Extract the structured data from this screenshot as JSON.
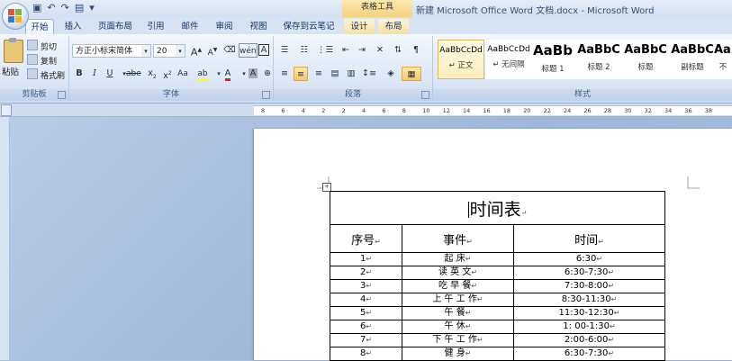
{
  "window": {
    "title": "新建 Microsoft Office Word 文档.docx - Microsoft Word",
    "context_group": "表格工具"
  },
  "tabs": [
    {
      "label": "开始",
      "active": true
    },
    {
      "label": "插入"
    },
    {
      "label": "页面布局"
    },
    {
      "label": "引用"
    },
    {
      "label": "邮件"
    },
    {
      "label": "审阅"
    },
    {
      "label": "视图"
    },
    {
      "label": "保存到云笔记"
    },
    {
      "label": "设计",
      "context": true
    },
    {
      "label": "布局",
      "context": true
    }
  ],
  "clipboard": {
    "paste": "粘贴",
    "cut": "剪切",
    "copy": "复制",
    "format_painter": "格式刷",
    "label": "剪贴板"
  },
  "font": {
    "name": "方正小标宋简体",
    "size": "20",
    "grow": "A",
    "shrink": "A",
    "bold": "B",
    "italic": "I",
    "underline": "U",
    "strike": "abe",
    "subscript": "x",
    "superscript": "x",
    "change_case": "Aa",
    "clear": "A",
    "highlight": "ab",
    "color": "A",
    "char_border": "A",
    "enclose": "⊕",
    "label": "字体"
  },
  "paragraph": {
    "label": "段落"
  },
  "styles": {
    "label": "样式",
    "items": [
      {
        "preview": "AaBbCcDd",
        "name": "↵ 正文",
        "selected": true
      },
      {
        "preview": "AaBbCcDd",
        "name": "↵ 无间隔"
      },
      {
        "preview": "AaBb",
        "name": "标题 1"
      },
      {
        "preview": "AaBbC",
        "name": "标题 2"
      },
      {
        "preview": "AaBbC",
        "name": "标题"
      },
      {
        "preview": "AaBbC",
        "name": "副标题"
      },
      {
        "preview": "AaB",
        "name": "不"
      }
    ]
  },
  "ruler": {
    "ticks": [
      "8",
      "6",
      "4",
      "2",
      "2",
      "4",
      "6",
      "8",
      "10",
      "12",
      "14",
      "16",
      "18",
      "20",
      "22",
      "24",
      "26",
      "28",
      "30",
      "32",
      "34",
      "36",
      "38"
    ]
  },
  "document": {
    "table_title": "时间表",
    "headers": [
      "序号",
      "事件",
      "时间"
    ],
    "rows": [
      [
        "1",
        "起 床",
        "6:30"
      ],
      [
        "2",
        "读 英 文",
        "6:30-7:30"
      ],
      [
        "3",
        "吃 早 餐",
        "7:30-8:00"
      ],
      [
        "4",
        "上 午 工 作",
        "8:30-11:30"
      ],
      [
        "5",
        "午 餐",
        "11:30-12:30"
      ],
      [
        "6",
        "午 休",
        "1: 00-1:30"
      ],
      [
        "7",
        "下 午 工 作",
        "2:00-6:00"
      ],
      [
        "8",
        "健 身",
        "6:30-7:30"
      ]
    ],
    "cell_mark": "↵"
  },
  "colors": {
    "ribbon": "#dbe6f5",
    "workspace": "#a9bfdc",
    "highlight": "#f7c86a"
  }
}
